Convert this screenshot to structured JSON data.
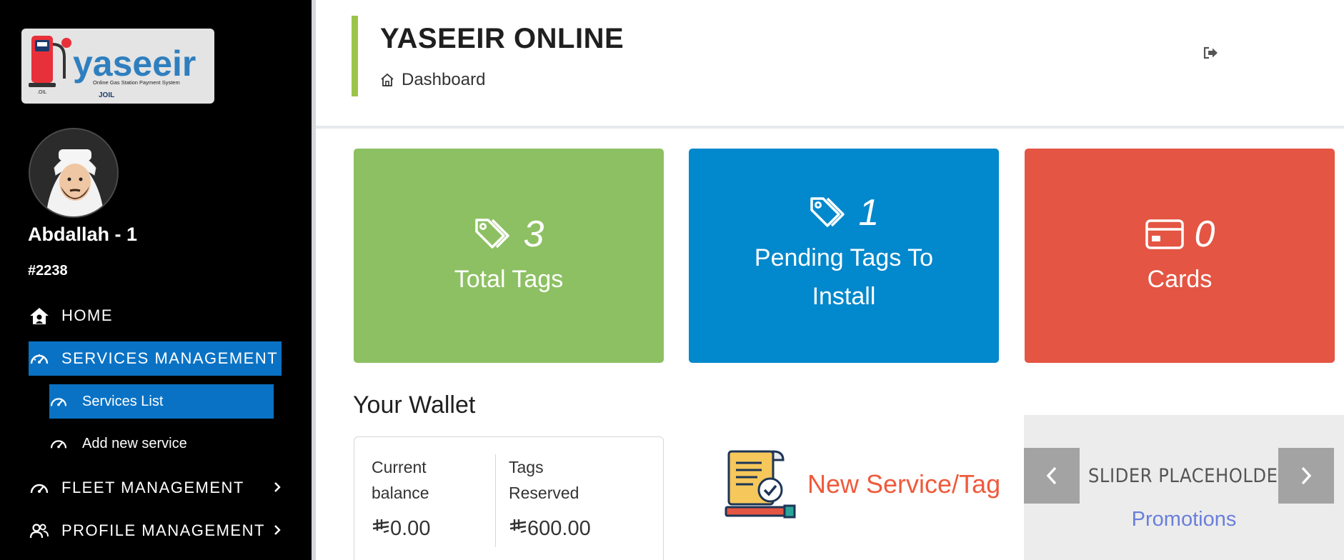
{
  "app": {
    "logo_text": "yaseeir",
    "logo_tagline": "Online Gas Station Payment System",
    "logo_brand": "JOIL"
  },
  "user": {
    "name": "Abdallah - 1",
    "id": "#2238"
  },
  "sidebar": {
    "items": [
      {
        "label": "HOME",
        "icon": "home-icon"
      },
      {
        "label": "SERVICES MANAGEMENT",
        "icon": "gauge-icon",
        "active": true
      },
      {
        "label": "FLEET MANAGEMENT",
        "icon": "gauge-icon",
        "has_children": true
      },
      {
        "label": "PROFILE MANAGEMENT",
        "icon": "users-icon",
        "has_children": true
      }
    ],
    "sub_items": [
      {
        "label": "Services List",
        "icon": "gauge-icon",
        "active": true
      },
      {
        "label": "Add new service",
        "icon": "gauge-icon"
      }
    ]
  },
  "header": {
    "title": "YASEEIR ONLINE",
    "breadcrumb": "Dashboard"
  },
  "stats": [
    {
      "value": "3",
      "label": "Total Tags",
      "icon": "tags-icon",
      "color": "#8dc063"
    },
    {
      "value": "1",
      "label": "Pending Tags To Install",
      "icon": "tags-icon",
      "color": "#0288cc"
    },
    {
      "value": "0",
      "label": "Cards",
      "icon": "credit-card-icon",
      "color": "#e45543"
    }
  ],
  "wallet": {
    "title": "Your Wallet",
    "current_balance_label": "Current balance",
    "current_balance_value": "0.00",
    "tags_reserved_label": "Tags Reserved",
    "tags_reserved_value": "600.00",
    "currency_symbol": "riyal-icon"
  },
  "new_service": {
    "label": "New Service/Tag"
  },
  "slider": {
    "placeholder": "SLIDER PLACEHOLDER",
    "link": "Promotions"
  },
  "colors": {
    "accent_blue": "#0a72c4",
    "header_accent": "#9cc44a"
  }
}
